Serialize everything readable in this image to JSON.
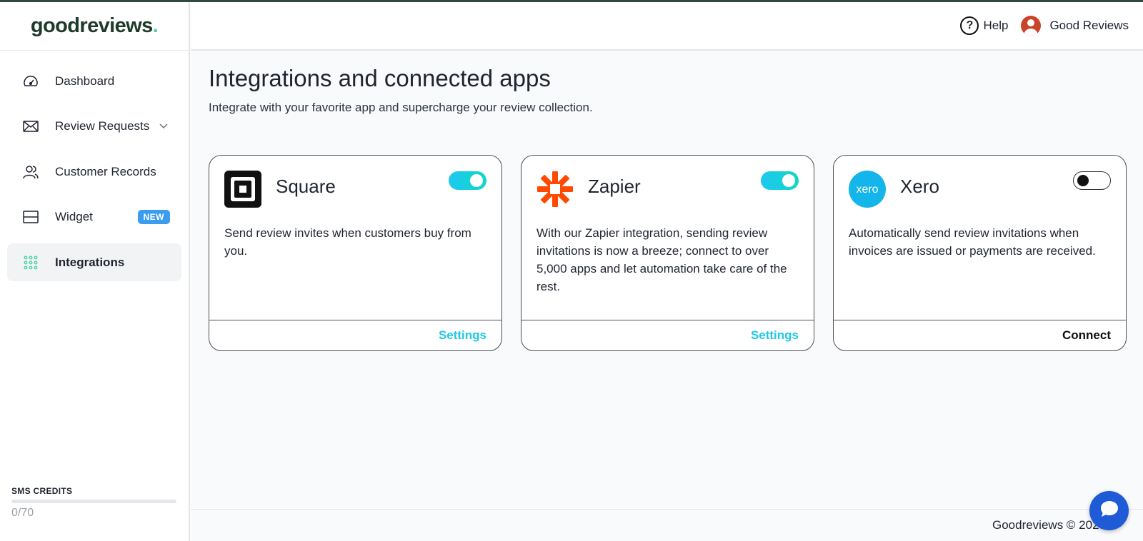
{
  "brand": {
    "name": "goodreviews",
    "dot": ".",
    "accent": "#4fd1a5"
  },
  "header": {
    "help_label": "Help",
    "user_name": "Good Reviews"
  },
  "sidebar": {
    "items": [
      {
        "label": "Dashboard",
        "icon": "gauge-icon"
      },
      {
        "label": "Review Requests",
        "icon": "envelope-icon"
      },
      {
        "label": "Customer Records",
        "icon": "users-icon"
      },
      {
        "label": "Widget",
        "icon": "layout-icon",
        "badge": "NEW"
      },
      {
        "label": "Integrations",
        "icon": "grid-dots-icon",
        "active": true
      }
    ],
    "sms": {
      "label": "SMS CREDITS",
      "count": "0/70",
      "used_fraction": 0
    }
  },
  "main": {
    "title": "Integrations and connected apps",
    "subtitle": "Integrate with your favorite app and supercharge your review collection.",
    "cards": [
      {
        "name": "Square",
        "enabled": true,
        "description": "Send review invites when customers buy from you.",
        "action": "Settings"
      },
      {
        "name": "Zapier",
        "enabled": true,
        "description": "With our Zapier integration, sending review invitations is now a breeze; connect to over 5,000 apps and let automation take care of the rest.",
        "action": "Settings"
      },
      {
        "name": "Xero",
        "logo_text": "xero",
        "enabled": false,
        "description": "Automatically send review invitations when invoices are issued or payments are received.",
        "action": "Connect"
      }
    ]
  },
  "footer": {
    "text": "Goodreviews © 2023"
  }
}
